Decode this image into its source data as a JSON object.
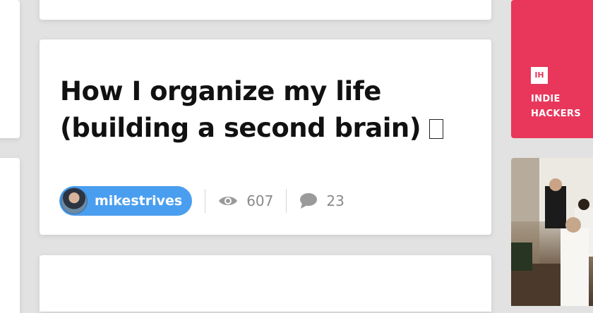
{
  "post": {
    "title": "How I organize my life (building a second brain)",
    "emoji": "",
    "author": "mikestrives",
    "views": "607",
    "comments": "23"
  },
  "sidebar": {
    "ih_logo": "IH",
    "ih_line1": "INDIE",
    "ih_line2": "HACKERS",
    "accent_color": "#e9365b"
  },
  "colors": {
    "author_pill": "#4a9eef",
    "meta_text": "#8a8a8a"
  },
  "icons": [
    "eye-icon",
    "comment-icon"
  ]
}
